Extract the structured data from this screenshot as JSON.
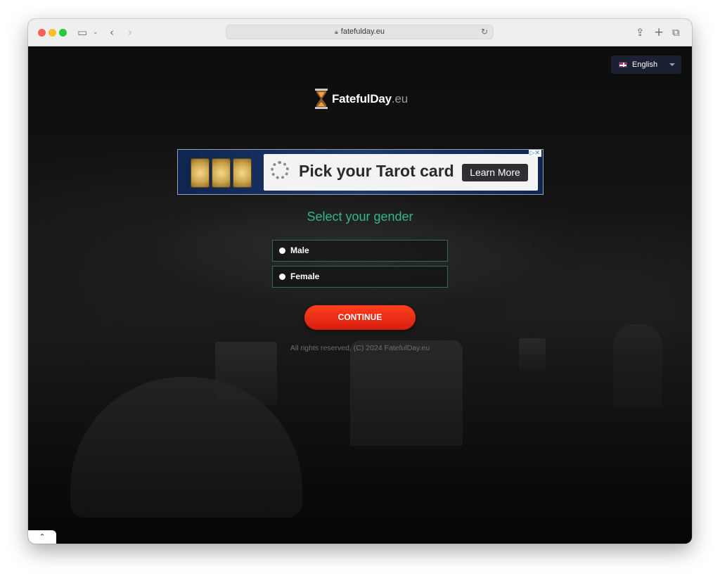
{
  "browser": {
    "url": "fatefulday.eu"
  },
  "language": {
    "selected": "English",
    "flag_icon": "uk-flag-icon"
  },
  "logo": {
    "name": "FatefulDay",
    "tld": ".eu",
    "icon": "hourglass-icon"
  },
  "ad": {
    "title": "Pick your Tarot card",
    "button_label": "Learn More",
    "choices_icon": "adchoices-icon"
  },
  "form": {
    "heading": "Select your gender",
    "options": [
      {
        "label": "Male"
      },
      {
        "label": "Female"
      }
    ],
    "continue_label": "CONTINUE"
  },
  "footer": {
    "text": "All rights reserved, (C) 2024 FatefulDay.eu"
  },
  "colors": {
    "accent_green": "#35b58f",
    "button_red": "#e82a14",
    "language_bg": "#1b2033"
  }
}
